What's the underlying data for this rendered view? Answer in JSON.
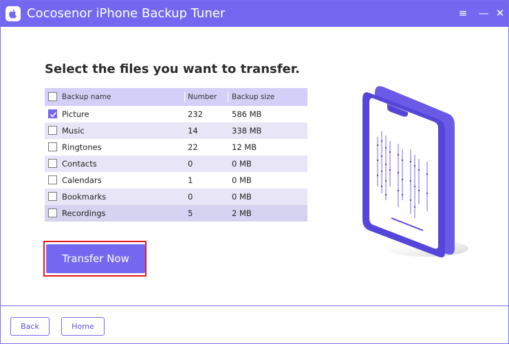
{
  "window": {
    "title": "Cocosenor iPhone Backup Tuner",
    "controls": {
      "menu": "≡",
      "minimize": "—",
      "close": "✕"
    }
  },
  "main": {
    "heading": "Select the files you want to transfer.",
    "table": {
      "headers": {
        "name": "Backup name",
        "number": "Number",
        "size": "Backup size"
      },
      "select_all_checked": false,
      "rows": [
        {
          "name": "Picture",
          "number": "232",
          "size": "586 MB",
          "checked": true
        },
        {
          "name": "Music",
          "number": "14",
          "size": "338 MB",
          "checked": false
        },
        {
          "name": "Ringtones",
          "number": "22",
          "size": "12 MB",
          "checked": false
        },
        {
          "name": "Contacts",
          "number": "0",
          "size": "0 MB",
          "checked": false
        },
        {
          "name": "Calendars",
          "number": "1",
          "size": "0 MB",
          "checked": false
        },
        {
          "name": "Bookmarks",
          "number": "0",
          "size": "0 MB",
          "checked": false
        },
        {
          "name": "Recordings",
          "number": "5",
          "size": "2 MB",
          "checked": false
        }
      ]
    },
    "transfer_label": "Transfer Now"
  },
  "footer": {
    "back_label": "Back",
    "home_label": "Home"
  },
  "colors": {
    "accent": "#7468f0",
    "highlight_border": "#e31919",
    "header_row": "#d3cff6",
    "alt_row": "#e8e6f6"
  }
}
